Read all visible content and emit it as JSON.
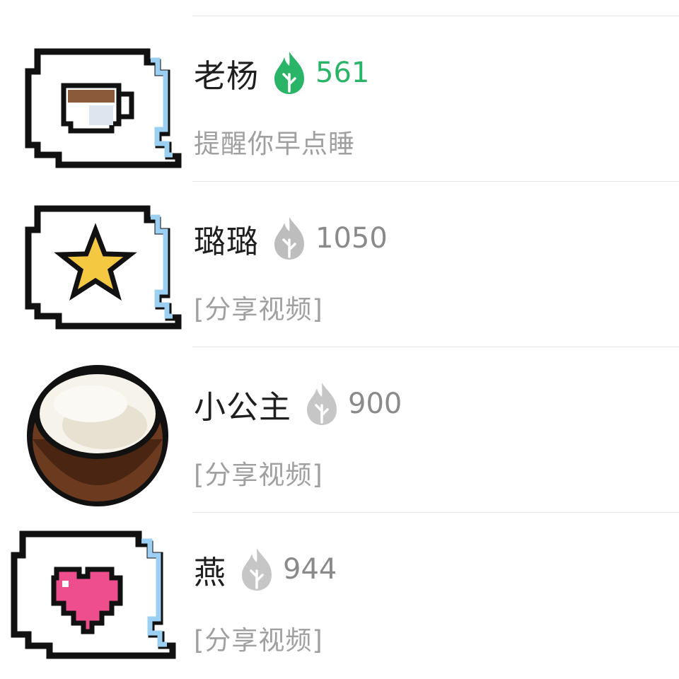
{
  "colors": {
    "accent_green": "#2ab468",
    "inactive_gray": "#8a8a8a",
    "subtitle_gray": "#a0a0a0"
  },
  "contacts": [
    {
      "name": "老杨",
      "streak_count": "561",
      "streak_state": "active",
      "last_message": "提醒你早点睡",
      "avatar_icon": "coffee-cup-speech-bubble-icon"
    },
    {
      "name": "璐璐",
      "streak_count": "1050",
      "streak_state": "inactive",
      "last_message": "[分享视频]",
      "avatar_icon": "star-speech-bubble-icon"
    },
    {
      "name": "小公主",
      "streak_count": "900",
      "streak_state": "inactive",
      "last_message": "[分享视频]",
      "avatar_icon": "coconut-icon"
    },
    {
      "name": "燕",
      "streak_count": "944",
      "streak_state": "inactive",
      "last_message": "[分享视频]",
      "avatar_icon": "heart-speech-bubble-icon"
    }
  ]
}
